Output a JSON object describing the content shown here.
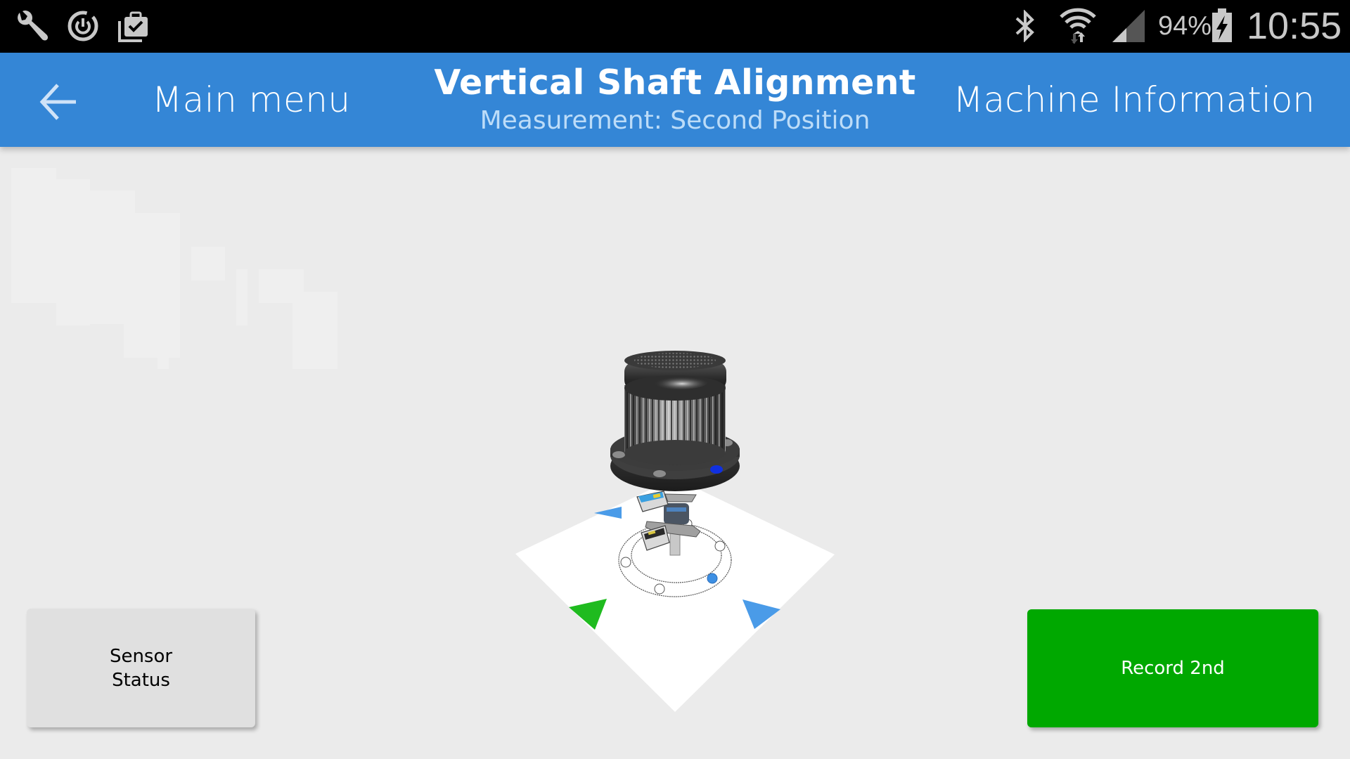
{
  "status_bar": {
    "left_icons": [
      "wrench-icon",
      "sync-power-icon",
      "briefcase-check-icon"
    ],
    "right_icons": [
      "bluetooth-icon",
      "wifi-icon",
      "signal-icon",
      "battery-charging-icon"
    ],
    "battery_percent": "94%",
    "time": "10:55"
  },
  "header": {
    "back_label": "Main menu",
    "title": "Vertical Shaft Alignment",
    "subtitle": "Measurement: Second Position",
    "right_action": "Machine Information"
  },
  "scene": {
    "description": "3D model of vertical motor on flange with two alignment sensors mounted on shaft, standing on a white isometric base plate",
    "markers": {
      "top_left_triangle_color": "#4a9be8",
      "bottom_left_triangle_color": "#1fbb1f",
      "bottom_right_triangle_color": "#4a9be8",
      "active_position_dot_color": "#3d8fe3",
      "flange_marker_color": "#1030e0"
    }
  },
  "buttons": {
    "sensor_status": "Sensor Status",
    "sensor_status_line1": "Sensor",
    "sensor_status_line2": "Status",
    "record": "Record 2nd"
  },
  "colors": {
    "header_blue": "#3486d6",
    "record_green": "#00a800",
    "background": "#ebebeb"
  }
}
